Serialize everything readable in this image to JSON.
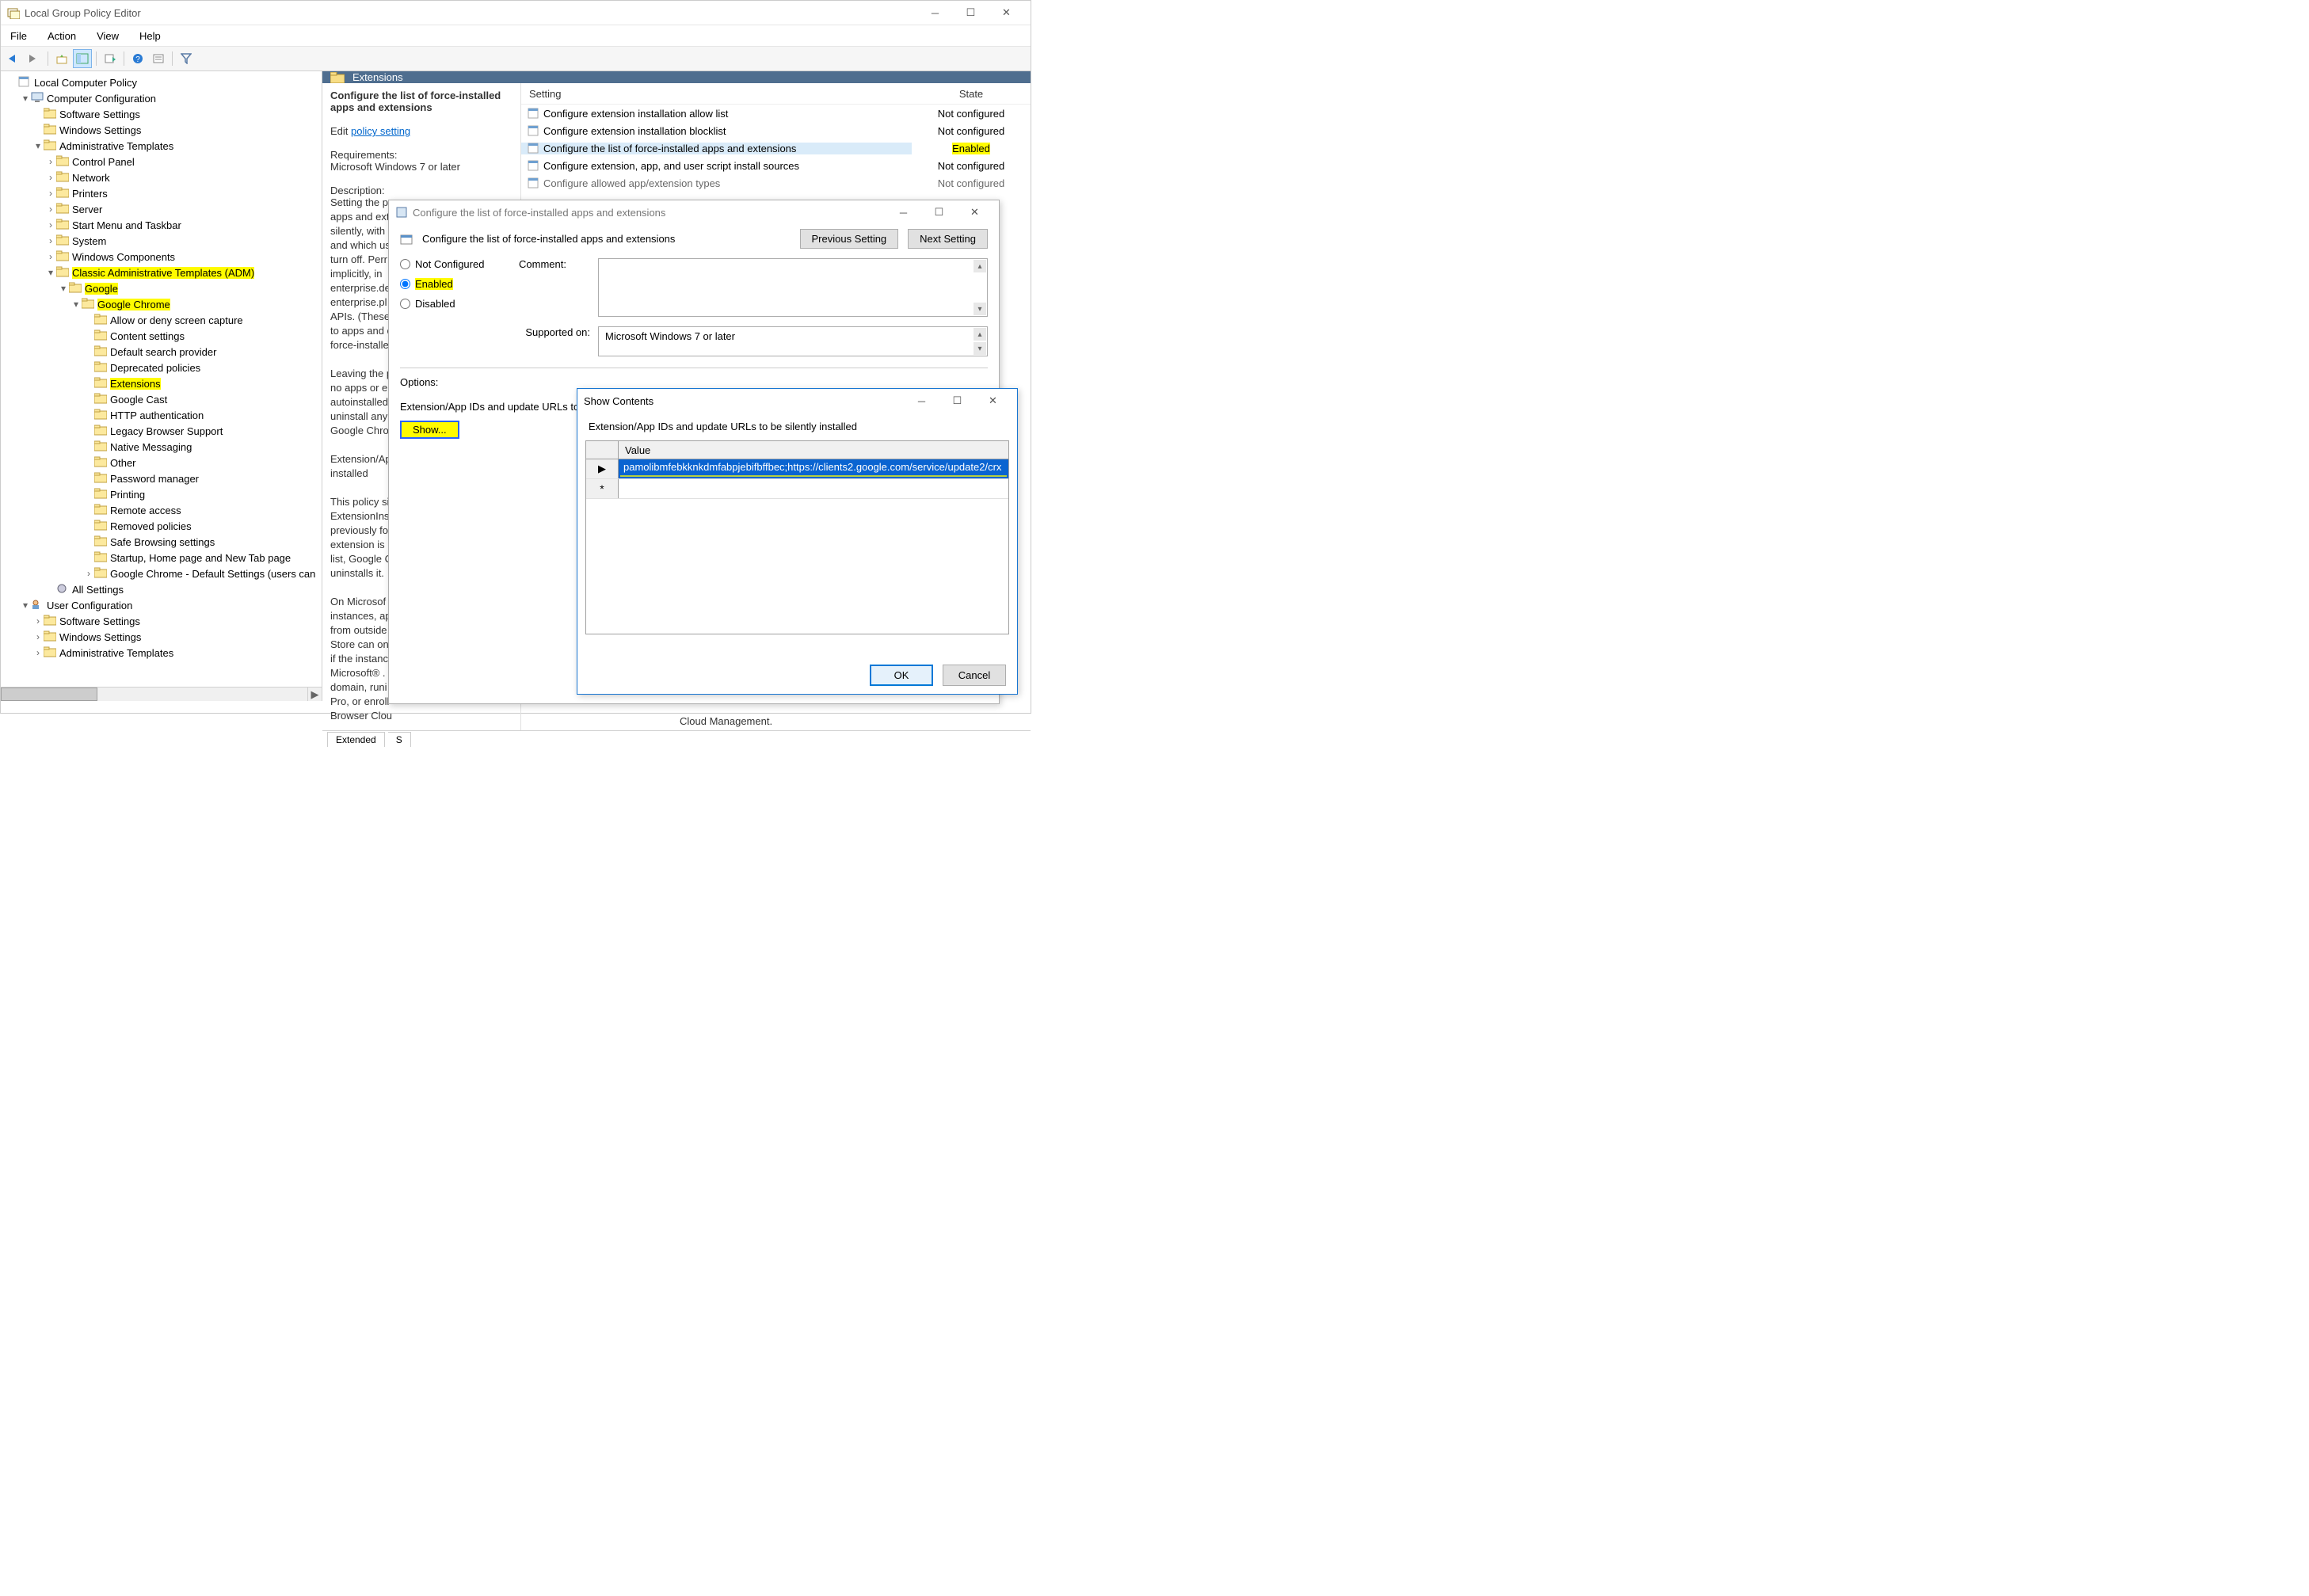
{
  "title": "Local Group Policy Editor",
  "menus": [
    "File",
    "Action",
    "View",
    "Help"
  ],
  "tree_root": "Local Computer Policy",
  "computer_config": "Computer Configuration",
  "software_settings": "Software Settings",
  "windows_settings": "Windows Settings",
  "admin_templates": "Administrative Templates",
  "adm_children": [
    "Control Panel",
    "Network",
    "Printers",
    "Server",
    "Start Menu and Taskbar",
    "System",
    "Windows Components"
  ],
  "classic_adm": "Classic Administrative Templates (ADM)",
  "google": "Google",
  "chrome": "Google Chrome",
  "chrome_children": [
    "Allow or deny screen capture",
    "Content settings",
    "Default search provider",
    "Deprecated policies",
    "Extensions",
    "Google Cast",
    "HTTP authentication",
    "Legacy Browser Support",
    "Native Messaging",
    "Other",
    "Password manager",
    "Printing",
    "Remote access",
    "Removed policies",
    "Safe Browsing settings",
    "Startup, Home page and New Tab page",
    "Google Chrome - Default Settings (users can"
  ],
  "all_settings": "All Settings",
  "user_config": "User Configuration",
  "detail_title": "Extensions",
  "desc_title": "Configure the list of force-installed apps and extensions",
  "edit_label": "Edit ",
  "policy_link": "policy setting",
  "req_label": "Requirements:",
  "req_value": "Microsoft Windows 7 or later",
  "desc_label": "Description:",
  "desc_lines": [
    "Setting the p",
    "apps and ext",
    "silently, with",
    "and which us",
    "turn off. Perr",
    "implicitly, in",
    "enterprise.de",
    "enterprise.pl",
    "APIs. (These",
    "to apps and e",
    "force-installe",
    "",
    "Leaving the p",
    "no apps or e",
    "autoinstalled",
    "uninstall any",
    "Google Chro",
    "",
    "Extension/App IDs and update URLs to",
    "installed",
    "",
    "This policy si",
    "ExtensionIns",
    "previously fo",
    "extension is r",
    "list, Google C",
    "uninstalls it.",
    "",
    "On Microsof",
    "instances, ap",
    "from outside",
    "Store can on",
    "if the instanc",
    "Microsoft® .",
    "domain, runi",
    "Pro, or enroll",
    "Browser Clou"
  ],
  "options_label": "Options:",
  "show_label": "Show...",
  "list_head_setting": "Setting",
  "list_head_state": "State",
  "settings": [
    {
      "name": "Configure extension installation allow list",
      "state": "Not configured"
    },
    {
      "name": "Configure extension installation blocklist",
      "state": "Not configured"
    },
    {
      "name": "Configure the list of force-installed apps and extensions",
      "state": "Enabled",
      "sel": true,
      "hl": true
    },
    {
      "name": "Configure extension, app, and user script install sources",
      "state": "Not configured"
    },
    {
      "name": "Configure allowed app/extension types",
      "state": "Not configured",
      "cut": true
    }
  ],
  "tabs": [
    "Extended",
    "S"
  ],
  "bottom_note": "Cloud Management.",
  "dlg1": {
    "title": "Configure the list of force-installed apps and extensions",
    "heading": "Configure the list of force-installed apps and extensions",
    "prev": "Previous Setting",
    "next": "Next Setting",
    "not_conf": "Not Configured",
    "enabled": "Enabled",
    "disabled": "Disabled",
    "comment": "Comment:",
    "supported": "Supported on:",
    "supported_value": "Microsoft Windows 7 or later",
    "opt_heading": "Extension/App IDs and update URLs to be silently installed"
  },
  "dlg2": {
    "title": "Show Contents",
    "label": "Extension/App IDs and update URLs to be silently installed",
    "col": "Value",
    "row_value": "pamolibmfebkknkdmfabpjebifbffbec;https://clients2.google.com/service/update2/crx",
    "ok": "OK",
    "cancel": "Cancel"
  }
}
